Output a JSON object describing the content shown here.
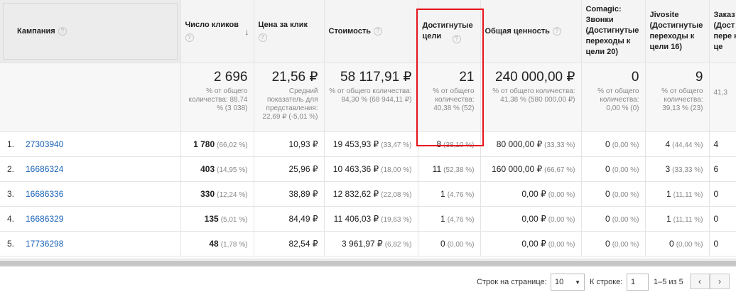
{
  "headers": {
    "campaign": "Кампания",
    "clicks": "Число кликов",
    "cpc": "Цена за клик",
    "cost": "Стоимость",
    "goals": "Достигнутые цели",
    "value": "Общая ценность",
    "comagic": "Comagic: Звонки (Достигнутые переходы к цели 20)",
    "jivosite": "Jivosite (Достигнутые переходы к цели 16)",
    "orders": "Заказ (Дост пере к це"
  },
  "summary": {
    "clicks": {
      "big": "2 696",
      "small": "% от общего количества: 88,74 % (3 038)"
    },
    "cpc": {
      "big": "21,56 ₽",
      "small": "Средний показатель для представления: 22,69 ₽ (-5,01 %)"
    },
    "cost": {
      "big": "58 117,91 ₽",
      "small": "% от общего количества: 84,30 % (68 944,11 ₽)"
    },
    "goals": {
      "big": "21",
      "small": "% от общего количества: 40,38 % (52)"
    },
    "value": {
      "big": "240 000,00 ₽",
      "small": "% от общего количества: 41,38 % (580 000,00 ₽)"
    },
    "comagic": {
      "big": "0",
      "small": "% от общего количества: 0,00 % (0)"
    },
    "jivosite": {
      "big": "9",
      "small": "% от общего количества: 39,13 % (23)"
    },
    "orders": {
      "big": "",
      "small": "41,3"
    }
  },
  "rows": [
    {
      "num": "1.",
      "campaign": "27303940",
      "clicks": "1 780",
      "clicks_pct": "(66,02 %)",
      "cpc": "10,93 ₽",
      "cost": "19 453,93 ₽",
      "cost_pct": "(33,47 %)",
      "goals": "8",
      "goals_pct": "(38,10 %)",
      "value": "80 000,00 ₽",
      "value_pct": "(33,33 %)",
      "comagic": "0",
      "comagic_pct": "(0,00 %)",
      "jivosite": "4",
      "jivosite_pct": "(44,44 %)",
      "orders": "4"
    },
    {
      "num": "2.",
      "campaign": "16686324",
      "clicks": "403",
      "clicks_pct": "(14,95 %)",
      "cpc": "25,96 ₽",
      "cost": "10 463,36 ₽",
      "cost_pct": "(18,00 %)",
      "goals": "11",
      "goals_pct": "(52,38 %)",
      "value": "160 000,00 ₽",
      "value_pct": "(66,67 %)",
      "comagic": "0",
      "comagic_pct": "(0,00 %)",
      "jivosite": "3",
      "jivosite_pct": "(33,33 %)",
      "orders": "6"
    },
    {
      "num": "3.",
      "campaign": "16686336",
      "clicks": "330",
      "clicks_pct": "(12,24 %)",
      "cpc": "38,89 ₽",
      "cost": "12 832,62 ₽",
      "cost_pct": "(22,08 %)",
      "goals": "1",
      "goals_pct": "(4,76 %)",
      "value": "0,00 ₽",
      "value_pct": "(0,00 %)",
      "comagic": "0",
      "comagic_pct": "(0,00 %)",
      "jivosite": "1",
      "jivosite_pct": "(11,11 %)",
      "orders": "0"
    },
    {
      "num": "4.",
      "campaign": "16686329",
      "clicks": "135",
      "clicks_pct": "(5,01 %)",
      "cpc": "84,49 ₽",
      "cost": "11 406,03 ₽",
      "cost_pct": "(19,63 %)",
      "goals": "1",
      "goals_pct": "(4,76 %)",
      "value": "0,00 ₽",
      "value_pct": "(0,00 %)",
      "comagic": "0",
      "comagic_pct": "(0,00 %)",
      "jivosite": "1",
      "jivosite_pct": "(11,11 %)",
      "orders": "0"
    },
    {
      "num": "5.",
      "campaign": "17736298",
      "clicks": "48",
      "clicks_pct": "(1,78 %)",
      "cpc": "82,54 ₽",
      "cost": "3 961,97 ₽",
      "cost_pct": "(6,82 %)",
      "goals": "0",
      "goals_pct": "(0,00 %)",
      "value": "0,00 ₽",
      "value_pct": "(0,00 %)",
      "comagic": "0",
      "comagic_pct": "(0,00 %)",
      "jivosite": "0",
      "jivosite_pct": "(0,00 %)",
      "orders": "0"
    }
  ],
  "pager": {
    "rows_label": "Строк на странице:",
    "rows_value": "10",
    "goto_label": "К строке:",
    "goto_value": "1",
    "range": "1–5 из 5",
    "prev": "‹",
    "next": "›"
  },
  "colors": {
    "highlight": "#e8141c",
    "link": "#1a63b8"
  },
  "icons": {
    "help": "help-circle-icon",
    "sort": "sort-down-arrow-icon",
    "caret": "caret-down-icon"
  }
}
